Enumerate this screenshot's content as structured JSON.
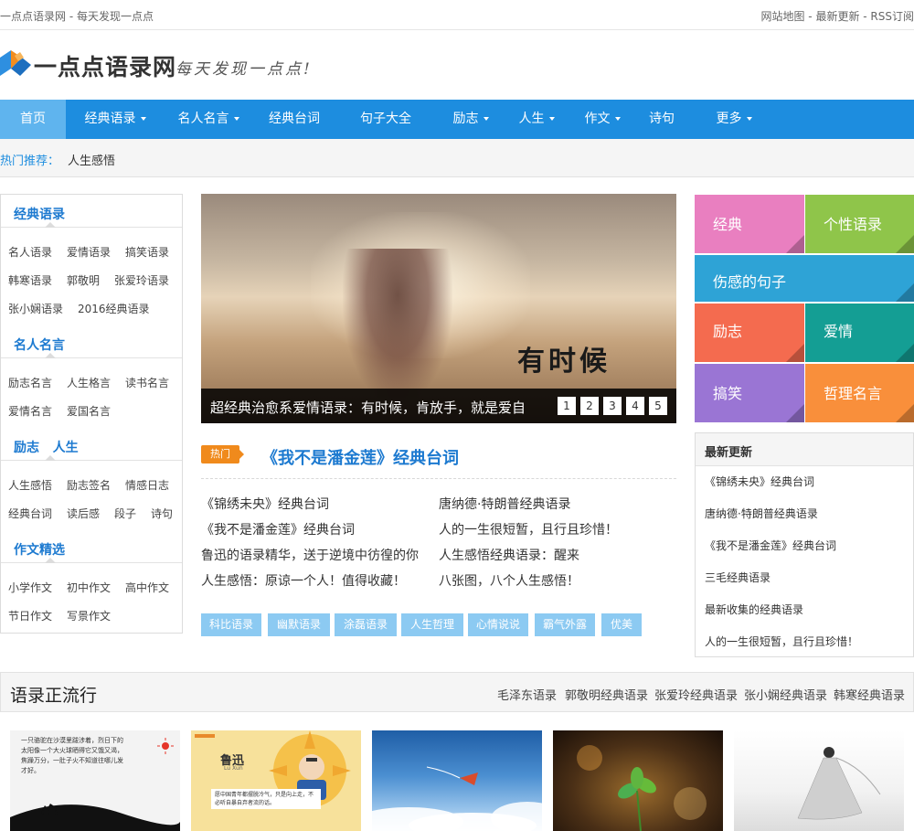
{
  "topbar": {
    "left_text": "一点点语录网 - 每天发现一点点",
    "right_links": [
      "网站地图",
      "最新更新",
      "RSS订阅"
    ],
    "separator": " - "
  },
  "header": {
    "logo_text": "一点点语录网",
    "slogan": "每天发现一点点!"
  },
  "nav": {
    "items": [
      {
        "label": "首页",
        "dropdown": false,
        "active": true
      },
      {
        "label": "经典语录",
        "dropdown": true
      },
      {
        "label": "名人名言",
        "dropdown": true
      },
      {
        "label": "经典台词",
        "dropdown": false
      },
      {
        "label": "句子大全",
        "dropdown": false
      },
      {
        "label": "励志",
        "dropdown": true
      },
      {
        "label": "人生",
        "dropdown": true
      },
      {
        "label": "作文",
        "dropdown": true
      },
      {
        "label": "诗句",
        "dropdown": false
      },
      {
        "label": "更多",
        "dropdown": true
      }
    ]
  },
  "hot": {
    "label": "热门推荐：",
    "link": "人生感悟"
  },
  "sidebar": {
    "sections": [
      {
        "title": "经典语录",
        "links": [
          "名人语录",
          "爱情语录",
          "搞笑语录",
          "韩寒语录",
          "郭敬明",
          "张爱玲语录",
          "张小娴语录",
          "2016经典语录"
        ]
      },
      {
        "title": "名人名言",
        "links": [
          "励志名言",
          "人生格言",
          "读书名言",
          "爱情名言",
          "爱国名言"
        ]
      },
      {
        "title": "励志   人生",
        "links": [
          "人生感悟",
          "励志签名",
          "情感日志",
          "经典台词",
          "读后感",
          "段子",
          "诗句"
        ]
      },
      {
        "title": "作文精选",
        "links": [
          "小学作文",
          "初中作文",
          "高中作文",
          "节日作文",
          "写景作文"
        ]
      }
    ]
  },
  "slider": {
    "image_text": "有时候",
    "caption": "超经典治愈系爱情语录：有时候，肯放手，就是爱自",
    "pages": [
      "1",
      "2",
      "3",
      "4",
      "5"
    ]
  },
  "headline": {
    "tag": "热门",
    "title": "《我不是潘金莲》经典台词"
  },
  "articles": [
    "《锦绣未央》经典台词",
    "唐纳德·特朗普经典语录",
    "《我不是潘金莲》经典台词",
    "人的一生很短暂，且行且珍惜！",
    "鲁迅的语录精华，送于逆境中彷徨的你",
    "人生感悟经典语录：醒来",
    "人生感悟：原谅一个人！值得收藏！",
    "八张图，八个人生感悟！"
  ],
  "tags": [
    "科比语录",
    "幽默语录",
    "涂磊语录",
    "人生哲理",
    "心情说说",
    "霸气外露",
    "优美"
  ],
  "tiles": [
    {
      "label": "经典",
      "color": "#e97fc0"
    },
    {
      "label": "个性语录",
      "color": "#8fc54a"
    },
    {
      "label": "伤感的句子",
      "color": "#2ea3d6"
    },
    {
      "label": "励志",
      "color": "#f46b4f"
    },
    {
      "label": "爱情",
      "color": "#149e94"
    },
    {
      "label": "搞笑",
      "color": "#9a75d4"
    },
    {
      "label": "哲理名言",
      "color": "#f98f3b"
    }
  ],
  "latest": {
    "title": "最新更新",
    "items": [
      "《锦绣未央》经典台词",
      "唐纳德·特朗普经典语录",
      "《我不是潘金莲》经典台词",
      "三毛经典语录",
      "最新收集的经典语录",
      "人的一生很短暂，且行且珍惜！"
    ]
  },
  "popular": {
    "title": "语录正流行",
    "links": [
      "毛泽东语录",
      "郭敬明经典语录",
      "张爱玲经典语录",
      "张小娴经典语录",
      "韩寒经典语录"
    ]
  },
  "thumbs": [
    {
      "text": "一只骆驼在沙漠里跋涉着，烈日下的太阳像一个大火球晒得它又饿又渴，焦躁万分，一肚子火不知道往哪儿发才好。"
    },
    {
      "name": "鲁迅",
      "sub": "Lu Xun",
      "text": "愿中国青年都摆脱冷气，只是向上走，不必听自暴自弃者流的话。"
    },
    {},
    {},
    {}
  ],
  "colors": {
    "nav_bg": "#1d8ddf",
    "nav_active": "#5fb4ee",
    "link_blue": "#1d7ad0",
    "hot_orange": "#f08a1c",
    "tag_bg": "#8ccaf2"
  }
}
